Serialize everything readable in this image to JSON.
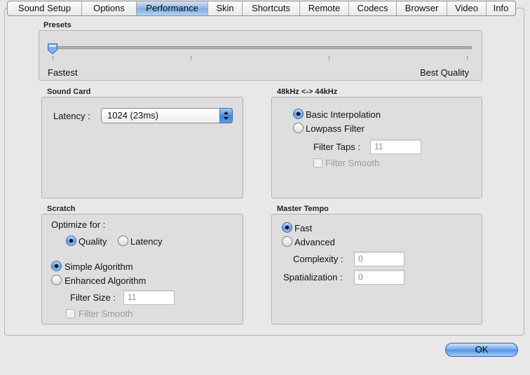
{
  "tabs": [
    {
      "label": "Sound Setup",
      "active": false
    },
    {
      "label": "Options",
      "active": false
    },
    {
      "label": "Performance",
      "active": true
    },
    {
      "label": "Skin",
      "active": false
    },
    {
      "label": "Shortcuts",
      "active": false
    },
    {
      "label": "Remote",
      "active": false
    },
    {
      "label": "Codecs",
      "active": false
    },
    {
      "label": "Browser",
      "active": false
    },
    {
      "label": "Video",
      "active": false
    },
    {
      "label": "Info",
      "active": false
    }
  ],
  "presets": {
    "title": "Presets",
    "min_label": "Fastest",
    "max_label": "Best Quality",
    "slider_value": 0
  },
  "sound_card": {
    "title": "Sound Card",
    "latency_label": "Latency :",
    "latency_value": "1024 (23ms)"
  },
  "resample": {
    "title": "48kHz <-> 44kHz",
    "basic_label": "Basic Interpolation",
    "lowpass_label": "Lowpass Filter",
    "selected": "basic",
    "filter_taps_label": "Filter Taps :",
    "filter_taps_value": "11",
    "filter_smooth_label": "Filter Smooth"
  },
  "scratch": {
    "title": "Scratch",
    "optimize_label": "Optimize for :",
    "quality_label": "Quality",
    "latency_label": "Latency",
    "optimize_selected": "quality",
    "simple_label": "Simple Algorithm",
    "enhanced_label": "Enhanced Algorithm",
    "algorithm_selected": "simple",
    "filter_size_label": "Filter Size :",
    "filter_size_value": "11",
    "filter_smooth_label": "Filter Smooth"
  },
  "master_tempo": {
    "title": "Master Tempo",
    "fast_label": "Fast",
    "advanced_label": "Advanced",
    "selected": "fast",
    "complexity_label": "Complexity :",
    "complexity_value": "0",
    "spatialization_label": "Spatialization :",
    "spatialization_value": "0"
  },
  "ok_label": "OK",
  "colors": {
    "accent": "#5f9ee8",
    "window_bg": "#e8e8e8",
    "group_bg": "#dedede"
  }
}
